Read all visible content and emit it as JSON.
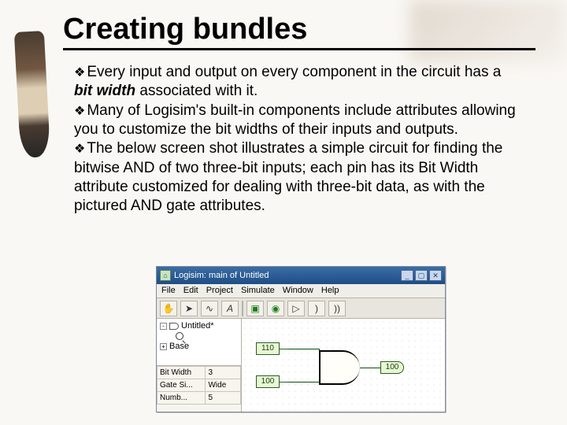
{
  "title": "Creating bundles",
  "bullets": {
    "b1a": "Every input and output on every component in the circuit has a ",
    "b1b": "bit width",
    "b1c": " associated with it.",
    "b2": "Many of Logisim's built-in components include attributes allowing you to customize the bit widths of their inputs and outputs.",
    "b3": "The below screen shot illustrates a simple circuit for finding the bitwise AND of two three-bit inputs; each pin has its Bit Width attribute customized for dealing with three-bit data, as with the pictured AND gate attributes."
  },
  "app": {
    "title": "Logisim: main of Untitled",
    "menus": [
      "File",
      "Edit",
      "Project",
      "Simulate",
      "Window",
      "Help"
    ],
    "toolbar_icons": [
      "hand-icon",
      "pointer-icon",
      "wire-icon",
      "text-a-icon",
      "pin-in-icon",
      "pin-out-icon",
      "not-icon",
      "and-icon",
      "or-icon"
    ],
    "tree": {
      "project": "Untitled*",
      "lib": "Base"
    },
    "props": {
      "rows": [
        {
          "k": "Bit Width",
          "v": "3"
        },
        {
          "k": "Gate Si...",
          "v": "Wide"
        },
        {
          "k": "Numb...",
          "v": "5"
        }
      ]
    },
    "pins": {
      "in1": "110",
      "in2": "100",
      "out": "100"
    }
  }
}
